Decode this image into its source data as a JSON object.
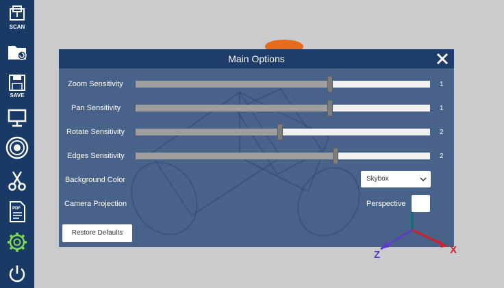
{
  "sidebar": {
    "items": [
      {
        "icon": "scan-icon",
        "label": "SCAN"
      },
      {
        "icon": "folder-icon",
        "label": ""
      },
      {
        "icon": "save-icon",
        "label": "SAVE"
      },
      {
        "icon": "monitor-icon",
        "label": ""
      },
      {
        "icon": "view-options-icon",
        "label": ""
      },
      {
        "icon": "scissors-icon",
        "label": ""
      },
      {
        "icon": "pdf-icon",
        "label": "PDF"
      },
      {
        "icon": "gear-icon",
        "label": ""
      },
      {
        "icon": "power-icon",
        "label": ""
      }
    ]
  },
  "dialog": {
    "title": "Main Options",
    "close_icon": "close-icon",
    "sliders": [
      {
        "label": "Zoom Sensitivity",
        "value": "1",
        "level": 0.66
      },
      {
        "label": "Pan Sensitivity",
        "value": "1",
        "level": 0.66
      },
      {
        "label": "Rotate Sensitivity",
        "value": "2",
        "level": 0.49
      },
      {
        "label": "Edges Sensitivity",
        "value": "2",
        "level": 0.68
      }
    ],
    "background_color": {
      "label": "Background Color",
      "selected": "Skybox"
    },
    "camera_projection": {
      "label": "Camera Projection",
      "option_label": "Perspective",
      "checked": false
    },
    "restore_button": "Restore Defaults"
  },
  "axes": {
    "x": "X",
    "z": "Z"
  },
  "colors": {
    "sidebar": "#1a3a66",
    "dialog": "#244476",
    "accent_green": "#7ed957",
    "axis_x": "#d0202a",
    "axis_z": "#5a3fc0",
    "axis_y": "#1d6d74"
  }
}
